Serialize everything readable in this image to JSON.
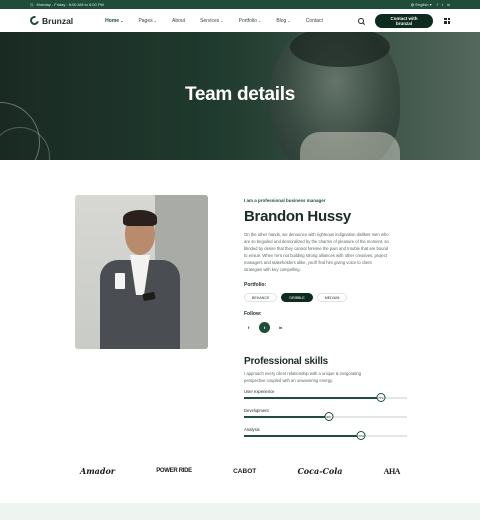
{
  "topbar": {
    "hours": "Monday - Friday : 8:00 AM to 6:00 PM",
    "language": "English",
    "social_icons": [
      "facebook-icon",
      "twitter-icon",
      "linkedin-icon"
    ]
  },
  "brand": {
    "name": "Brunzal",
    "accent": "#1f4d3a"
  },
  "nav": {
    "items": [
      {
        "label": "Home",
        "dropdown": true,
        "active": true
      },
      {
        "label": "Pages",
        "dropdown": true
      },
      {
        "label": "About",
        "dropdown": false
      },
      {
        "label": "Services",
        "dropdown": true
      },
      {
        "label": "Portfolio",
        "dropdown": true
      },
      {
        "label": "Blog",
        "dropdown": true
      },
      {
        "label": "Contact",
        "dropdown": false
      }
    ],
    "cta": "Contact with brunzal"
  },
  "hero": {
    "title": "Team details"
  },
  "profile": {
    "eyebrow": "I am a professional business manager",
    "name": "Brandon Hussy",
    "bio": "On the other hands, we denounce with righteous indignation dislikes men who are so beguiled and demoralized by the charms of pleasure of the moment, so blinded by desire that they cannot foresee the pain and trouble that are bound to ensue. When he's not building strong alliances with other creatives, project managers and stakeholders alike, you'll find him giving voice to client strategies with key compelling.",
    "portfolio_label": "Portfolio:",
    "portfolio": [
      {
        "label": "BEHANCE",
        "active": false
      },
      {
        "label": "DRIBBLE",
        "active": true
      },
      {
        "label": "MEDIUM",
        "active": false
      }
    ],
    "follow_label": "Follow:",
    "follow": [
      {
        "icon": "facebook-icon",
        "glyph": "f",
        "active": false
      },
      {
        "icon": "twitter-icon",
        "glyph": "t",
        "active": true
      },
      {
        "icon": "linkedin-icon",
        "glyph": "in",
        "active": false
      }
    ]
  },
  "skills": {
    "title": "Professional skills",
    "description": "I approach every client relationship with a unique & invigorating perspective coupled with an unwavering energy.",
    "items": [
      {
        "label": "User experience",
        "value": 0.84,
        "display": "75%"
      },
      {
        "label": "Development",
        "value": 0.52,
        "display": "40%"
      },
      {
        "label": "Analysis",
        "value": 0.72,
        "display": "60%"
      }
    ]
  },
  "brands": [
    "Amador",
    "POWER RIDE",
    "CABOT",
    "Coca-Cola",
    "AHA"
  ]
}
